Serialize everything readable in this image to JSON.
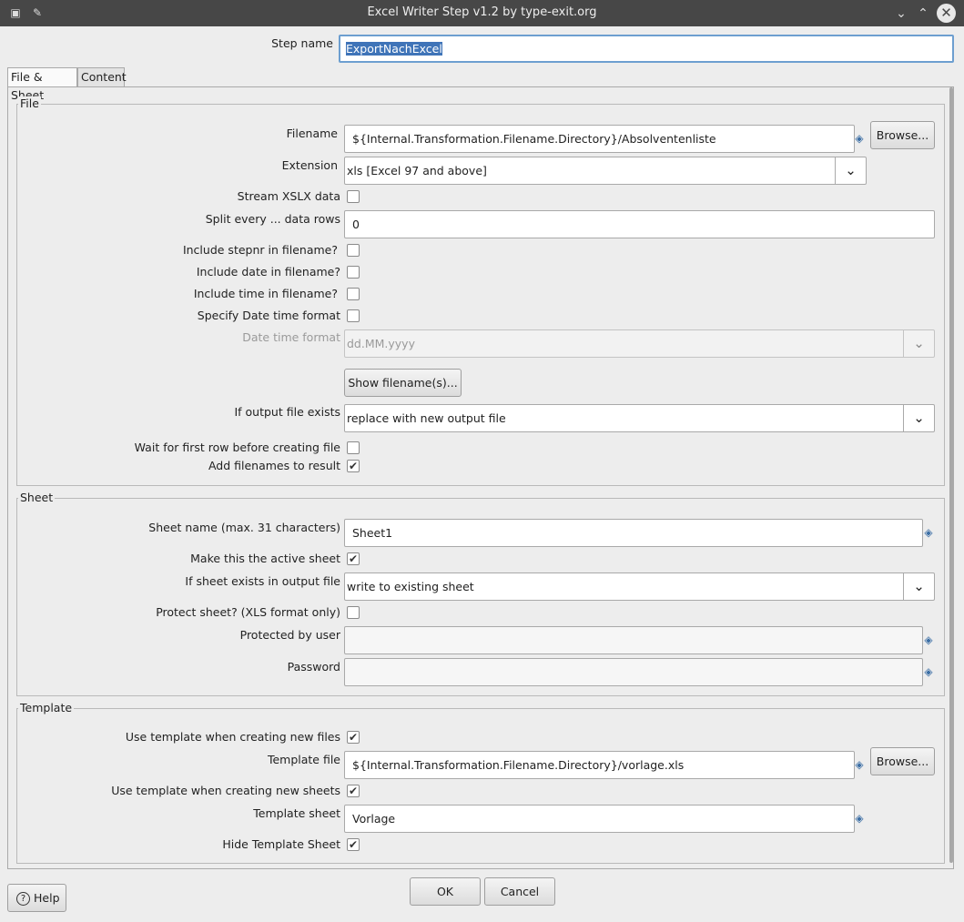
{
  "window": {
    "title": "Excel Writer Step v1.2 by type-exit.org",
    "app_icon": "app-icon",
    "pin_icon": "pin-icon"
  },
  "step_name": {
    "label": "Step name",
    "value": "ExportNachExcel"
  },
  "tabs": [
    {
      "label": "File & Sheet",
      "active": true
    },
    {
      "label": "Content",
      "active": false
    }
  ],
  "file_group": {
    "title": "File",
    "filename_label": "Filename",
    "filename_value": "${Internal.Transformation.Filename.Directory}/Absolventenliste",
    "browse_label": "Browse...",
    "extension_label": "Extension",
    "extension_value": "xls [Excel 97 and above]",
    "stream_label": "Stream XSLX data",
    "stream_checked": false,
    "split_label": "Split every ... data rows",
    "split_value": "0",
    "stepnr_label": "Include stepnr in filename?",
    "stepnr_checked": false,
    "date_label": "Include date in filename?",
    "date_checked": false,
    "time_label": "Include time in filename?",
    "time_checked": false,
    "specify_dt_label": "Specify Date time format",
    "specify_dt_checked": false,
    "dt_format_label": "Date time format",
    "dt_format_value": "dd.MM.yyyy",
    "show_filenames_label": "Show filename(s)...",
    "if_exists_label": "If output file exists",
    "if_exists_value": "replace with new output file",
    "wait_first_row_label": "Wait for first row before creating file",
    "wait_first_row_checked": false,
    "add_filenames_label": "Add filenames to result",
    "add_filenames_checked": true
  },
  "sheet_group": {
    "title": "Sheet",
    "sheet_name_label": "Sheet name (max. 31 characters)",
    "sheet_name_value": "Sheet1",
    "active_sheet_label": "Make this the active sheet",
    "active_sheet_checked": true,
    "if_sheet_exists_label": "If sheet exists in output file",
    "if_sheet_exists_value": "write to existing sheet",
    "protect_label": "Protect sheet? (XLS format only)",
    "protect_checked": false,
    "protected_by_label": "Protected by user",
    "protected_by_value": "",
    "password_label": "Password",
    "password_value": ""
  },
  "template_group": {
    "title": "Template",
    "use_template_files_label": "Use template when creating new files",
    "use_template_files_checked": true,
    "template_file_label": "Template file",
    "template_file_value": "${Internal.Transformation.Filename.Directory}/vorlage.xls",
    "browse_label": "Browse...",
    "use_template_sheets_label": "Use template when creating new sheets",
    "use_template_sheets_checked": true,
    "template_sheet_label": "Template sheet",
    "template_sheet_value": "Vorlage",
    "hide_template_label": "Hide Template Sheet",
    "hide_template_checked": true
  },
  "footer": {
    "help_label": "Help",
    "ok_label": "OK",
    "cancel_label": "Cancel"
  },
  "icons": {
    "check_glyph": "✔",
    "variable_glyph": "◈",
    "dropdown_glyph": "⌄"
  }
}
